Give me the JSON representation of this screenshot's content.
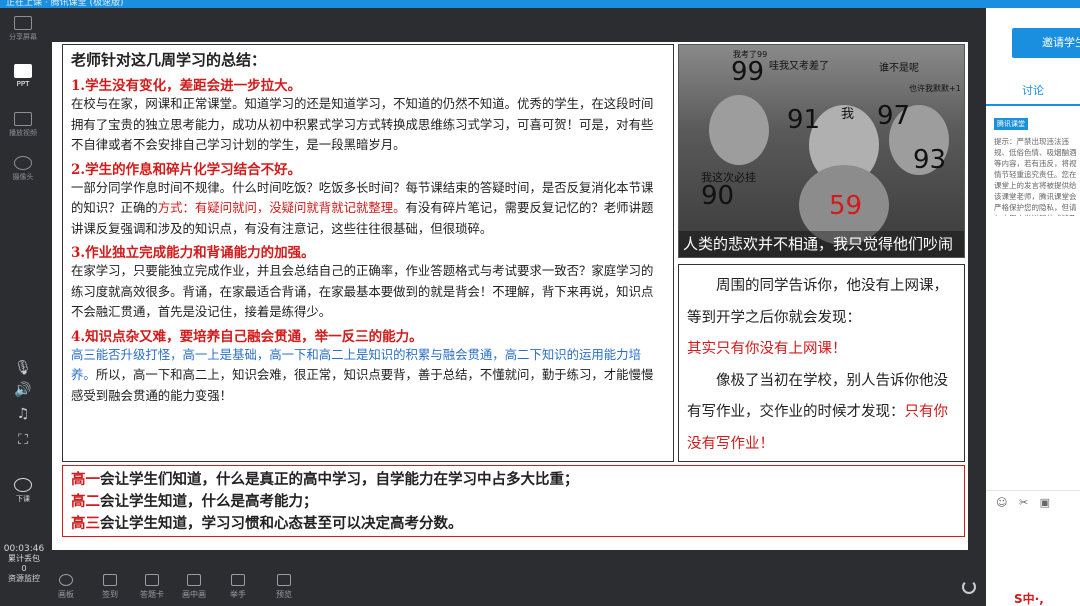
{
  "window": {
    "title": "正在上课 · 腾讯课堂 (极速版)"
  },
  "sidebar": {
    "items": [
      {
        "label": "分享屏幕",
        "icon": "share-screen-icon"
      },
      {
        "label": "PPT",
        "icon": "ppt-icon"
      },
      {
        "label": "播放视频",
        "icon": "play-video-icon"
      },
      {
        "label": "摄像头",
        "icon": "camera-icon"
      }
    ],
    "controls": [
      "mic-icon",
      "speaker-icon",
      "music-icon",
      "fullscreen-icon"
    ],
    "end_class_label": "下课",
    "timer": "00:03:46",
    "packet_loss_label": "累计丢包",
    "packet_loss_value": "0",
    "resource_label": "资源监控"
  },
  "slide": {
    "main": {
      "title": "老师针对这几周学习的总结：",
      "s1_heading": "1.学生没有变化，差距会进一步拉大。",
      "s1_body": "在校与在家，网课和正常课堂。知道学习的还是知道学习，不知道的仍然不知道。优秀的学生，在这段时间拥有了宝贵的独立思考能力，成功从初中积累式学习方式转换成思维练习式学习，可喜可贺！可是，对有些不自律或者不会安排自己学习计划的学生，是一段黑暗岁月。",
      "s2_heading": "2.学生的作息和碎片化学习结合不好。",
      "s2_body_a": "一部分同学作息时间不规律。什么时间吃饭？吃饭多长时间？每节课结束的答疑时间，是否反复消化本节课的知识？正确的",
      "s2_body_red": "方式：有疑问就问，没疑问就背就记就整理。",
      "s2_body_b": "有没有碎片笔记，需要反复记忆的？老师讲题讲课反复强调和涉及的知识点，有没有注意记，这些往往很基础，但很琐碎。",
      "s3_heading": "3.作业独立完成能力和背诵能力的加强。",
      "s3_body": "在家学习，只要能独立完成作业，并且会总结自己的正确率，作业答题格式与考试要求一致否？家庭学习的练习度就高效很多。背诵，在家最适合背诵，在家最基本要做到的就是背会！不理解，背下来再说，知识点不会融汇贯通，首先是没记住，接着是练得少。",
      "s4_heading": "4.知识点杂又难，要培养自己融会贯通，举一反三的能力。",
      "s4_body_blue": "高三能否升级打怪，高一上是基础，高一下和高二上是知识的积累与融会贯通，高二下知识的运用能力培养。",
      "s4_body_b": "所以，高一下和高二上，知识会难，很正常，知识点要背，善于总结，不懂就问，勤于练习，才能慢慢感受到融会贯通的能力变强！"
    },
    "photo": {
      "caption": "人类的悲欢并不相通，我只觉得他们吵闹",
      "numbers": [
        "99",
        "91",
        "97",
        "93",
        "90",
        "59"
      ],
      "labels": [
        "我考了99",
        "哇我又考差了",
        "谁不是呢",
        "我",
        "我这次必挂",
        "也许我默默+1"
      ]
    },
    "side": {
      "p1": "周围的同学告诉你，他没有上网课，等到开学之后你就会发现：",
      "p1_red": "其实只有你没有上网课！",
      "p2": "像极了当初在学校，别人告诉你他没有写作业，交作业的时候才发现：",
      "p2_red": "只有你没有写作业！"
    },
    "bottom": {
      "l1_pre": "高一",
      "l1_post": "会让学生们知道，什么是真正的高中学习，自学能力在学习中占多大比重；",
      "l2_pre": "高二",
      "l2_post": "会让学生知道，什么是高考能力；",
      "l3_pre": "高三",
      "l3_post": "会让学生知道，学习习惯和心态甚至可以决定高考分数。"
    }
  },
  "toolbar": {
    "items": [
      "画板",
      "签到",
      "答题卡",
      "画中画",
      "举手",
      "预览"
    ]
  },
  "chat": {
    "invite_label": "邀请学生",
    "tab_label": "讨论",
    "badge": "腾讯课堂",
    "tip": "提示：严禁出现违法违规、低俗色情、吸烟酗酒等内容，若有违反，将视情节轻重追究责任。您在课堂上的发言将被提供给该课堂老师，腾讯课堂会严格保护您的隐私，但请勿由用户发送短信或涉及个人隐私的内容，谢谢配合。",
    "tools": "☺ ✂ ▣",
    "brand": "S中·,"
  }
}
